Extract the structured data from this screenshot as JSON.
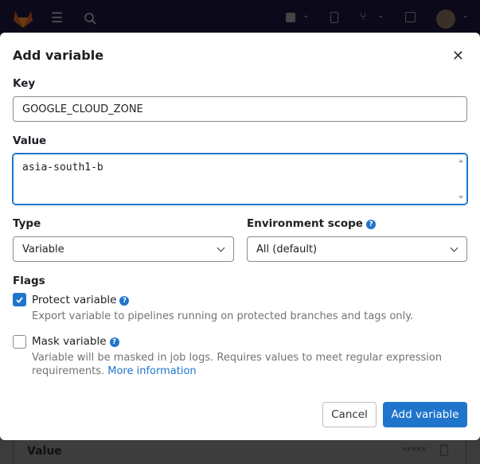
{
  "colors": {
    "accent": "#1f75cb",
    "overlay_bar": "#0c0a1a"
  },
  "topbar": {
    "icons": [
      "gitlab-logo",
      "hamburger-icon",
      "search-icon",
      "plus-square-icon",
      "issues-icon",
      "merge-request-icon",
      "todo-icon",
      "avatar"
    ]
  },
  "background": {
    "row_label": "Value",
    "masked_value": "*****"
  },
  "modal": {
    "title": "Add variable",
    "key": {
      "label": "Key",
      "value": "GOOGLE_CLOUD_ZONE"
    },
    "value": {
      "label": "Value",
      "value": "asia-south1-b"
    },
    "type": {
      "label": "Type",
      "selected": "Variable"
    },
    "env": {
      "label": "Environment scope",
      "selected": "All (default)"
    },
    "flags": {
      "label": "Flags",
      "protect": {
        "label": "Protect variable",
        "checked": true,
        "help": "Export variable to pipelines running on protected branches and tags only."
      },
      "mask": {
        "label": "Mask variable",
        "checked": false,
        "help": "Variable will be masked in job logs. Requires values to meet regular expression requirements.",
        "link": "More information"
      }
    },
    "cancel": "Cancel",
    "submit": "Add variable"
  }
}
